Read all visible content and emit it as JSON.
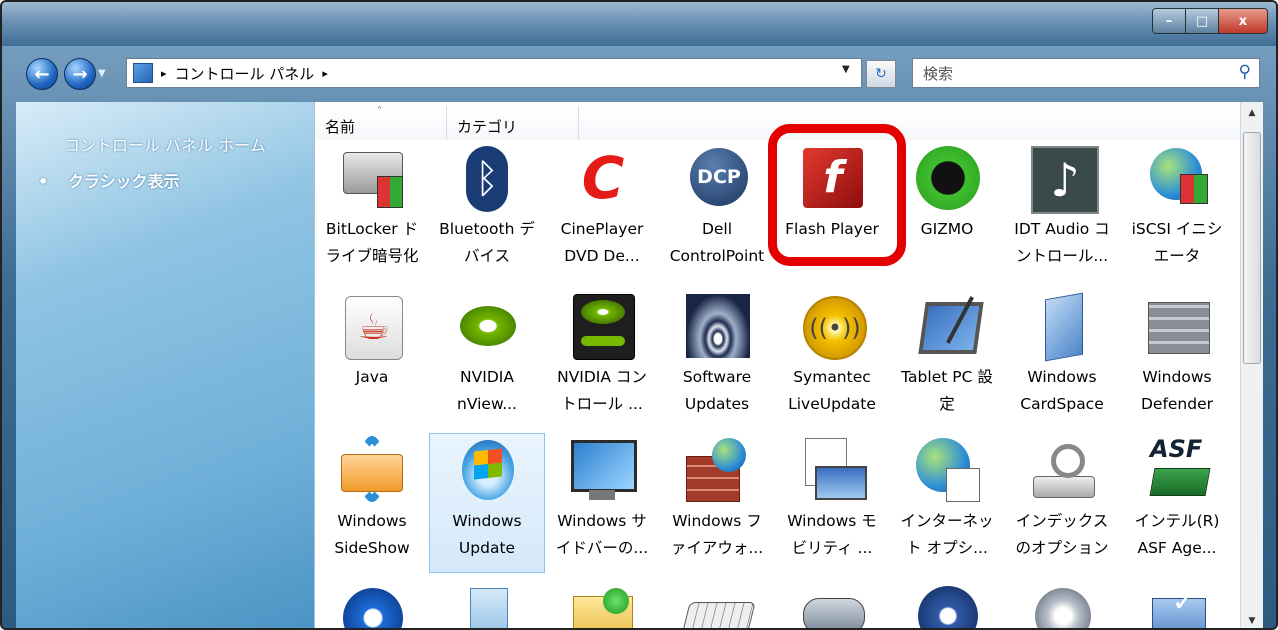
{
  "window": {
    "buttons": {
      "minimize": "–",
      "maximize": "□",
      "close": "x"
    }
  },
  "nav": {
    "back": "←",
    "forward": "→",
    "breadcrumb_sep": "▸",
    "breadcrumb": "コントロール パネル",
    "breadcrumb_tail": "▸",
    "dropdown": "▼",
    "refresh": "↻",
    "search_placeholder": "検索",
    "search_icon": "search-icon"
  },
  "sidebar": {
    "home": "コントロール パネル ホーム",
    "classic_bullet": "•",
    "classic": "クラシック表示"
  },
  "columns": {
    "name": "名前",
    "category": "カテゴリ"
  },
  "items": [
    {
      "l1": "BitLocker ド",
      "l2": "ライブ暗号化",
      "icon": "bitlocker-icon"
    },
    {
      "l1": "Bluetooth デ",
      "l2": "バイス",
      "icon": "bluetooth-icon"
    },
    {
      "l1": "CinePlayer",
      "l2": "DVD De...",
      "icon": "cineplayer-icon"
    },
    {
      "l1": "Dell",
      "l2": "ControlPoint",
      "icon": "dcp-icon"
    },
    {
      "l1": "Flash Player",
      "l2": "",
      "icon": "flash-icon"
    },
    {
      "l1": "GIZMO",
      "l2": "",
      "icon": "gizmo-icon"
    },
    {
      "l1": "IDT Audio コ",
      "l2": "ントロール...",
      "icon": "audio-note-icon"
    },
    {
      "l1": "iSCSI イニシ",
      "l2": "エータ",
      "icon": "iscsi-globe-icon"
    },
    {
      "l1": "Java",
      "l2": "",
      "icon": "java-icon"
    },
    {
      "l1": "NVIDIA",
      "l2": "nView...",
      "icon": "nvidia-icon"
    },
    {
      "l1": "NVIDIA コン",
      "l2": "トロール ...",
      "icon": "nvidia-control-icon"
    },
    {
      "l1": "Software",
      "l2": "Updates",
      "icon": "software-updates-icon"
    },
    {
      "l1": "Symantec",
      "l2": "LiveUpdate",
      "icon": "symantec-icon"
    },
    {
      "l1": "Tablet PC 設",
      "l2": "定",
      "icon": "tablet-icon"
    },
    {
      "l1": "Windows",
      "l2": "CardSpace",
      "icon": "cardspace-icon"
    },
    {
      "l1": "Windows",
      "l2": "Defender",
      "icon": "defender-icon"
    },
    {
      "l1": "Windows",
      "l2": "SideShow",
      "icon": "sideshow-icon"
    },
    {
      "l1": "Windows",
      "l2": "Update",
      "icon": "windows-update-icon"
    },
    {
      "l1": "Windows サ",
      "l2": "イドバーの...",
      "icon": "sidebar-monitor-icon"
    },
    {
      "l1": "Windows フ",
      "l2": "ァイアウォ...",
      "icon": "firewall-icon"
    },
    {
      "l1": "Windows モ",
      "l2": "ビリティ ...",
      "icon": "mobility-icon"
    },
    {
      "l1": "インターネッ",
      "l2": "ト オプシ...",
      "icon": "internet-options-icon"
    },
    {
      "l1": "インデックス",
      "l2": "のオプション",
      "icon": "indexing-icon"
    },
    {
      "l1": "インテル(R)",
      "l2": "ASF Age...",
      "icon": "asf-icon"
    },
    {
      "l1": "",
      "l2": "",
      "icon": "network-icon"
    },
    {
      "l1": "",
      "l2": "",
      "icon": "offline-files-icon"
    },
    {
      "l1": "",
      "l2": "",
      "icon": "folder-icon"
    },
    {
      "l1": "",
      "l2": "",
      "icon": "keyboard-icon"
    },
    {
      "l1": "",
      "l2": "",
      "icon": "game-controller-icon"
    },
    {
      "l1": "",
      "l2": "",
      "icon": "ease-of-access-icon"
    },
    {
      "l1": "",
      "l2": "",
      "icon": "sound-icon"
    },
    {
      "l1": "",
      "l2": "",
      "icon": "action-center-icon"
    }
  ],
  "scroll": {
    "up": "▲",
    "down": "▼"
  }
}
